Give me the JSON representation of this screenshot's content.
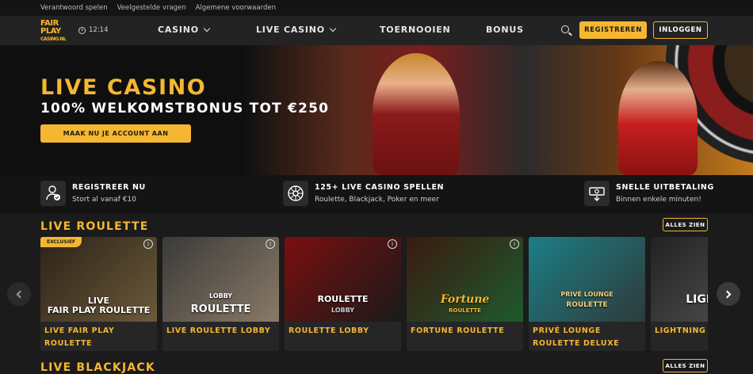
{
  "topbar": {
    "links": [
      "Verantwoord spelen",
      "Veelgestelde vragen",
      "Algemene voorwaarden"
    ]
  },
  "header": {
    "logo_line1": "FAIR",
    "logo_line2": "PLAY",
    "logo_line3": "CASINO.NL",
    "time": "12:14",
    "menu": [
      "CASINO",
      "LIVE CASINO",
      "TOERNOOIEN",
      "BONUS"
    ],
    "register_label": "REGISTREREN",
    "login_label": "INLOGGEN"
  },
  "hero": {
    "title": "LIVE CASINO",
    "subtitle": "100% WELKOMSTBONUS TOT €250",
    "cta_label": "MAAK NU JE ACCOUNT AAN"
  },
  "usps": [
    {
      "title": "REGISTREER NU",
      "text": "Stort al vanaf €10",
      "icon": "user-check-icon"
    },
    {
      "title": "125+ LIVE CASINO SPELLEN",
      "text": "Roulette, Blackjack, Poker en meer",
      "icon": "roulette-wheel-icon"
    },
    {
      "title": "SNELLE UITBETALING",
      "text": "Binnen enkele minuten!",
      "icon": "cash-payout-icon"
    }
  ],
  "sections": {
    "roulette_title": "LIVE ROULETTE",
    "blackjack_title": "LIVE BLACKJACK",
    "see_all_label": "ALLES ZIEN"
  },
  "games": [
    {
      "title": "LIVE FAIR PLAY ROULETTE",
      "badge": "EXCLUSIEF",
      "img_label": "LIVE\nFAIR PLAY ROULETTE",
      "color1": "#2c2218",
      "color2": "#6b5a3a"
    },
    {
      "title": "LIVE ROULETTE LOBBY",
      "img_label": "ROULETTE",
      "img_sub": "LOBBY",
      "color1": "#3a3a38",
      "color2": "#8a7a68"
    },
    {
      "title": "ROULETTE LOBBY",
      "img_label": "ROULETTE",
      "img_sub": "LOBBY",
      "color1": "#7a0f0f",
      "color2": "#1a1a1a"
    },
    {
      "title": "FORTUNE ROULETTE",
      "img_label": "Fortune",
      "img_sub": "ROULETTE",
      "color1": "#3a1a10",
      "color2": "#1e5a2e"
    },
    {
      "title": "PRIVÉ LOUNGE ROULETTE DELUXE",
      "img_label": "PRIVÉ LOUNGE",
      "img_sub": "ROULETTE",
      "color1": "#1b7f86",
      "color2": "#2f3a3a"
    },
    {
      "title": "LIGHTNING R",
      "img_label": "LIGHTN",
      "color1": "#222",
      "color2": "#555"
    }
  ],
  "colors": {
    "accent": "#f5b731",
    "background": "#1b1b1b"
  }
}
